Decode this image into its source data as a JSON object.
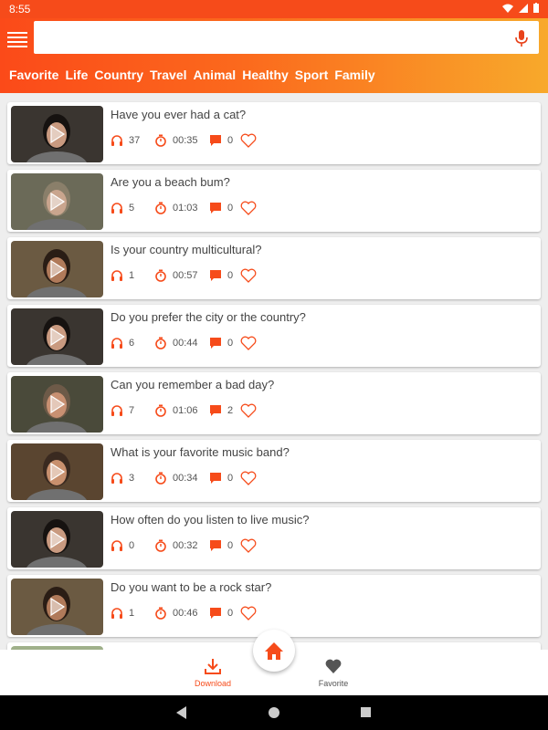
{
  "status_bar": {
    "time": "8:55"
  },
  "search": {
    "placeholder": "",
    "value": ""
  },
  "categories": [
    "Favorite",
    "Life",
    "Country",
    "Travel",
    "Animal",
    "Healthy",
    "Sport",
    "Family"
  ],
  "items": [
    {
      "title": "Have you ever had a cat?",
      "listens": "37",
      "duration": "00:35",
      "comments": "0"
    },
    {
      "title": "Are you a beach bum?",
      "listens": "5",
      "duration": "01:03",
      "comments": "0"
    },
    {
      "title": "Is your country multicultural?",
      "listens": "1",
      "duration": "00:57",
      "comments": "0"
    },
    {
      "title": "Do you prefer the city or the country?",
      "listens": "6",
      "duration": "00:44",
      "comments": "0"
    },
    {
      "title": "Can you remember a bad day?",
      "listens": "7",
      "duration": "01:06",
      "comments": "2"
    },
    {
      "title": "What is your favorite music band?",
      "listens": "3",
      "duration": "00:34",
      "comments": "0"
    },
    {
      "title": "How often do you listen to live music?",
      "listens": "0",
      "duration": "00:32",
      "comments": "0"
    },
    {
      "title": "Do you want to be a rock star?",
      "listens": "1",
      "duration": "00:46",
      "comments": "0"
    }
  ],
  "bottom_nav": {
    "download_label": "Download",
    "favorite_label": "Favorite"
  },
  "colors": {
    "accent": "#f64b1a",
    "gradient_end": "#f8a92b"
  },
  "icons": {
    "listens": "headphones-icon",
    "duration": "stopwatch-icon",
    "comments": "comment-icon",
    "like": "heart-outline-icon",
    "play": "play-icon"
  }
}
